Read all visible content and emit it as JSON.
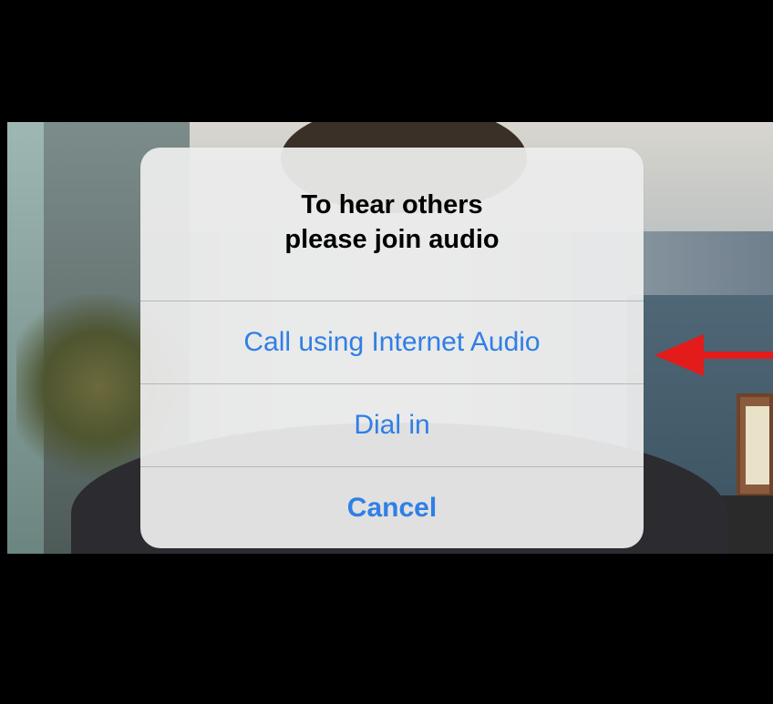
{
  "alert": {
    "title": "To hear others\nplease join audio",
    "buttons": [
      {
        "label": "Call using Internet Audio"
      },
      {
        "label": "Dial in"
      },
      {
        "label": "Cancel"
      }
    ]
  },
  "colors": {
    "accent": "#2f7fe5",
    "annotation": "#e31b1b"
  },
  "icons": {
    "annotation": "left-arrow-icon"
  }
}
